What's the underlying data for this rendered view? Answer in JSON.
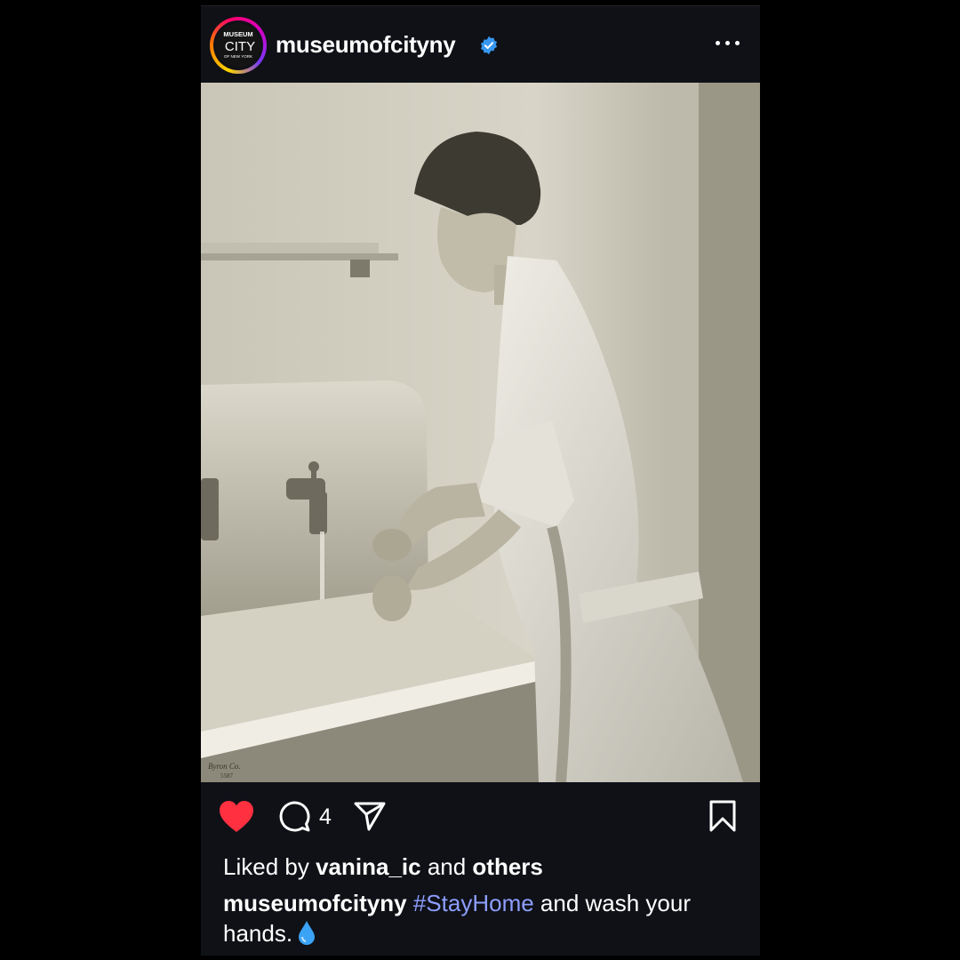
{
  "post": {
    "username": "museumofcityny",
    "verified": true,
    "avatar_text": [
      "MUSEUM",
      "CITY",
      "OF NEW YORK"
    ],
    "more_icon": "more-horizontal-icon",
    "photo_watermark": [
      "Byron Co.",
      "5587"
    ]
  },
  "actions": {
    "liked": true,
    "like_color": "#ff3040",
    "comment_count": "4",
    "icons": [
      "heart-icon",
      "comment-icon",
      "share-icon",
      "bookmark-icon"
    ]
  },
  "likes": {
    "prefix": "Liked by ",
    "user": "vanina_ic",
    "middle": " and ",
    "others": "others"
  },
  "caption": {
    "username": "museumofcityny",
    "hashtag": "#StayHome",
    "text": " and wash your hands.",
    "emoji_icon": "water-drop-icon",
    "hashtag_color": "#8d9eff"
  }
}
